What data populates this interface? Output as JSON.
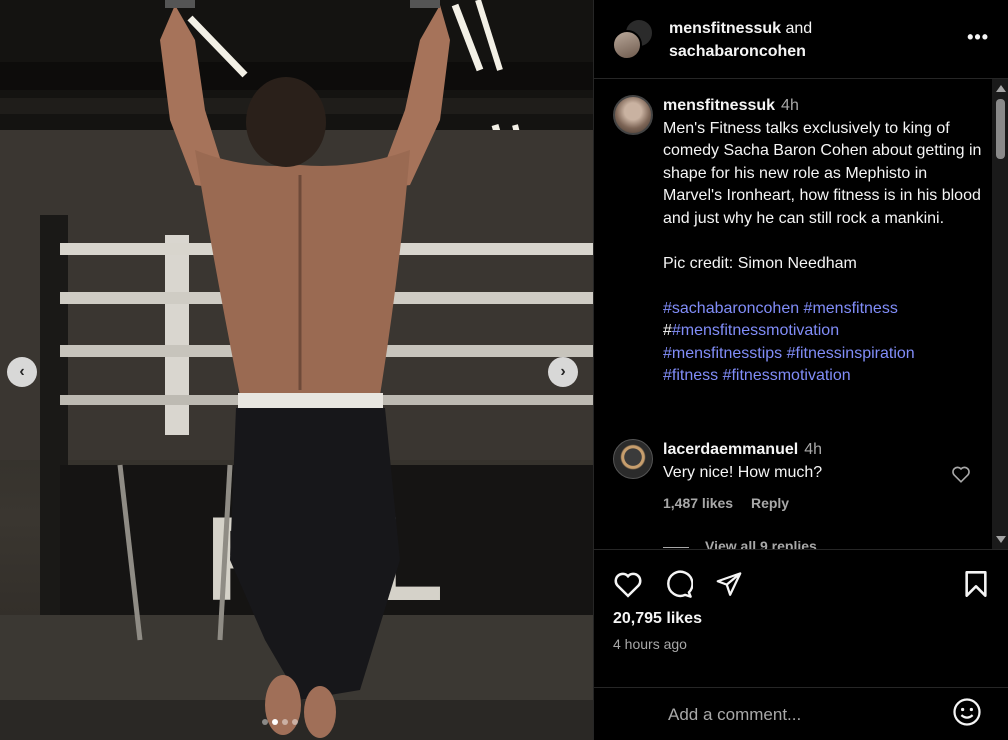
{
  "header": {
    "user1": "mensfitnessuk",
    "joiner": "and",
    "user2": "sachabaroncohen",
    "more_label": "•••"
  },
  "media": {
    "prev_glyph": "‹",
    "next_glyph": "›",
    "carousel_count": 4,
    "carousel_active": 1
  },
  "post": {
    "username": "mensfitnessuk",
    "time": "4h",
    "caption": "Men's Fitness talks exclusively to king of comedy Sacha Baron Cohen about getting in shape for his new role as Mephisto in Marvel's Ironheart, how fitness is in his blood and just why he can still rock a mankini.",
    "credit": "Pic credit: Simon Needham",
    "hashtags_line1": "#sachabaroncohen #mensfitness",
    "hash_prefix": "#",
    "hashtags_line2": "#mensfitnessmotivation",
    "hashtags_line3": "#mensfitnesstips #fitnessinspiration",
    "hashtags_line4": "#fitness #fitnessmotivation"
  },
  "comment": {
    "username": "lacerdaemmanuel",
    "time": "4h",
    "text": "Very nice! How much?",
    "likes": "1,487 likes",
    "reply": "Reply",
    "view_replies": "View all 9 replies"
  },
  "actions": {
    "likes": "20,795 likes",
    "time_ago": "4 hours ago"
  },
  "add_comment": {
    "placeholder": "Add a comment..."
  },
  "icons": {
    "like": "heart-icon",
    "comment": "comment-bubble-icon",
    "share": "paper-plane-icon",
    "save": "bookmark-icon",
    "emoji": "smiley-icon",
    "more": "more-dots-icon"
  }
}
